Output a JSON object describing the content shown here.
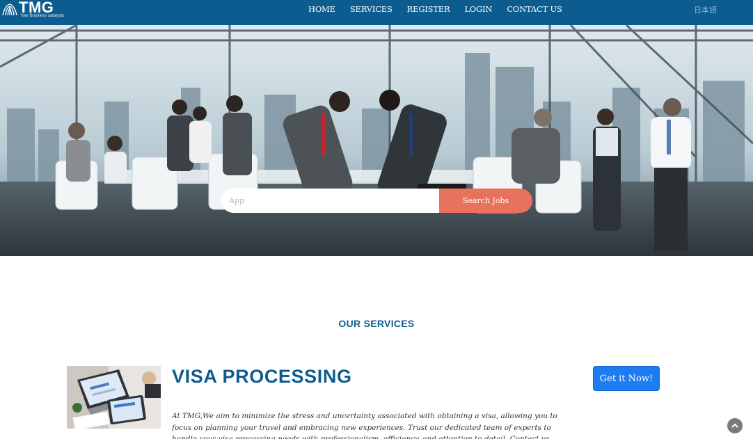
{
  "header": {
    "logo_text": "TMG",
    "logo_tagline": "Your Business catalysts",
    "nav": [
      "HOME",
      "SERVICES",
      "REGISTER",
      "LOGIN",
      "CONTACT US"
    ],
    "language": "日本語"
  },
  "hero": {
    "search_value": "",
    "search_placeholder": "App",
    "search_button": "Search Jobs"
  },
  "services": {
    "section_title": "OUR SERVICES",
    "items": [
      {
        "title": "VISA PROCESSING",
        "description": "At TMG,We aim to minimize the stress and uncertainty associated with obtaining a visa, allowing you to focus on planning your travel and embracing new experiences. Trust our dedicated team of experts to handle your visa processing needs with professionalism, efficiency, and attention to detail. Contact us today and embark on your",
        "button": "Get it Now!"
      }
    ]
  },
  "colors": {
    "nav_bg": "#0d5c8f",
    "accent_blue": "#0d5c8f",
    "search_button": "#e8735c",
    "cta_button": "#1d7cf2"
  },
  "icons": [
    "tmg-logo-icon",
    "scroll-top-icon"
  ]
}
